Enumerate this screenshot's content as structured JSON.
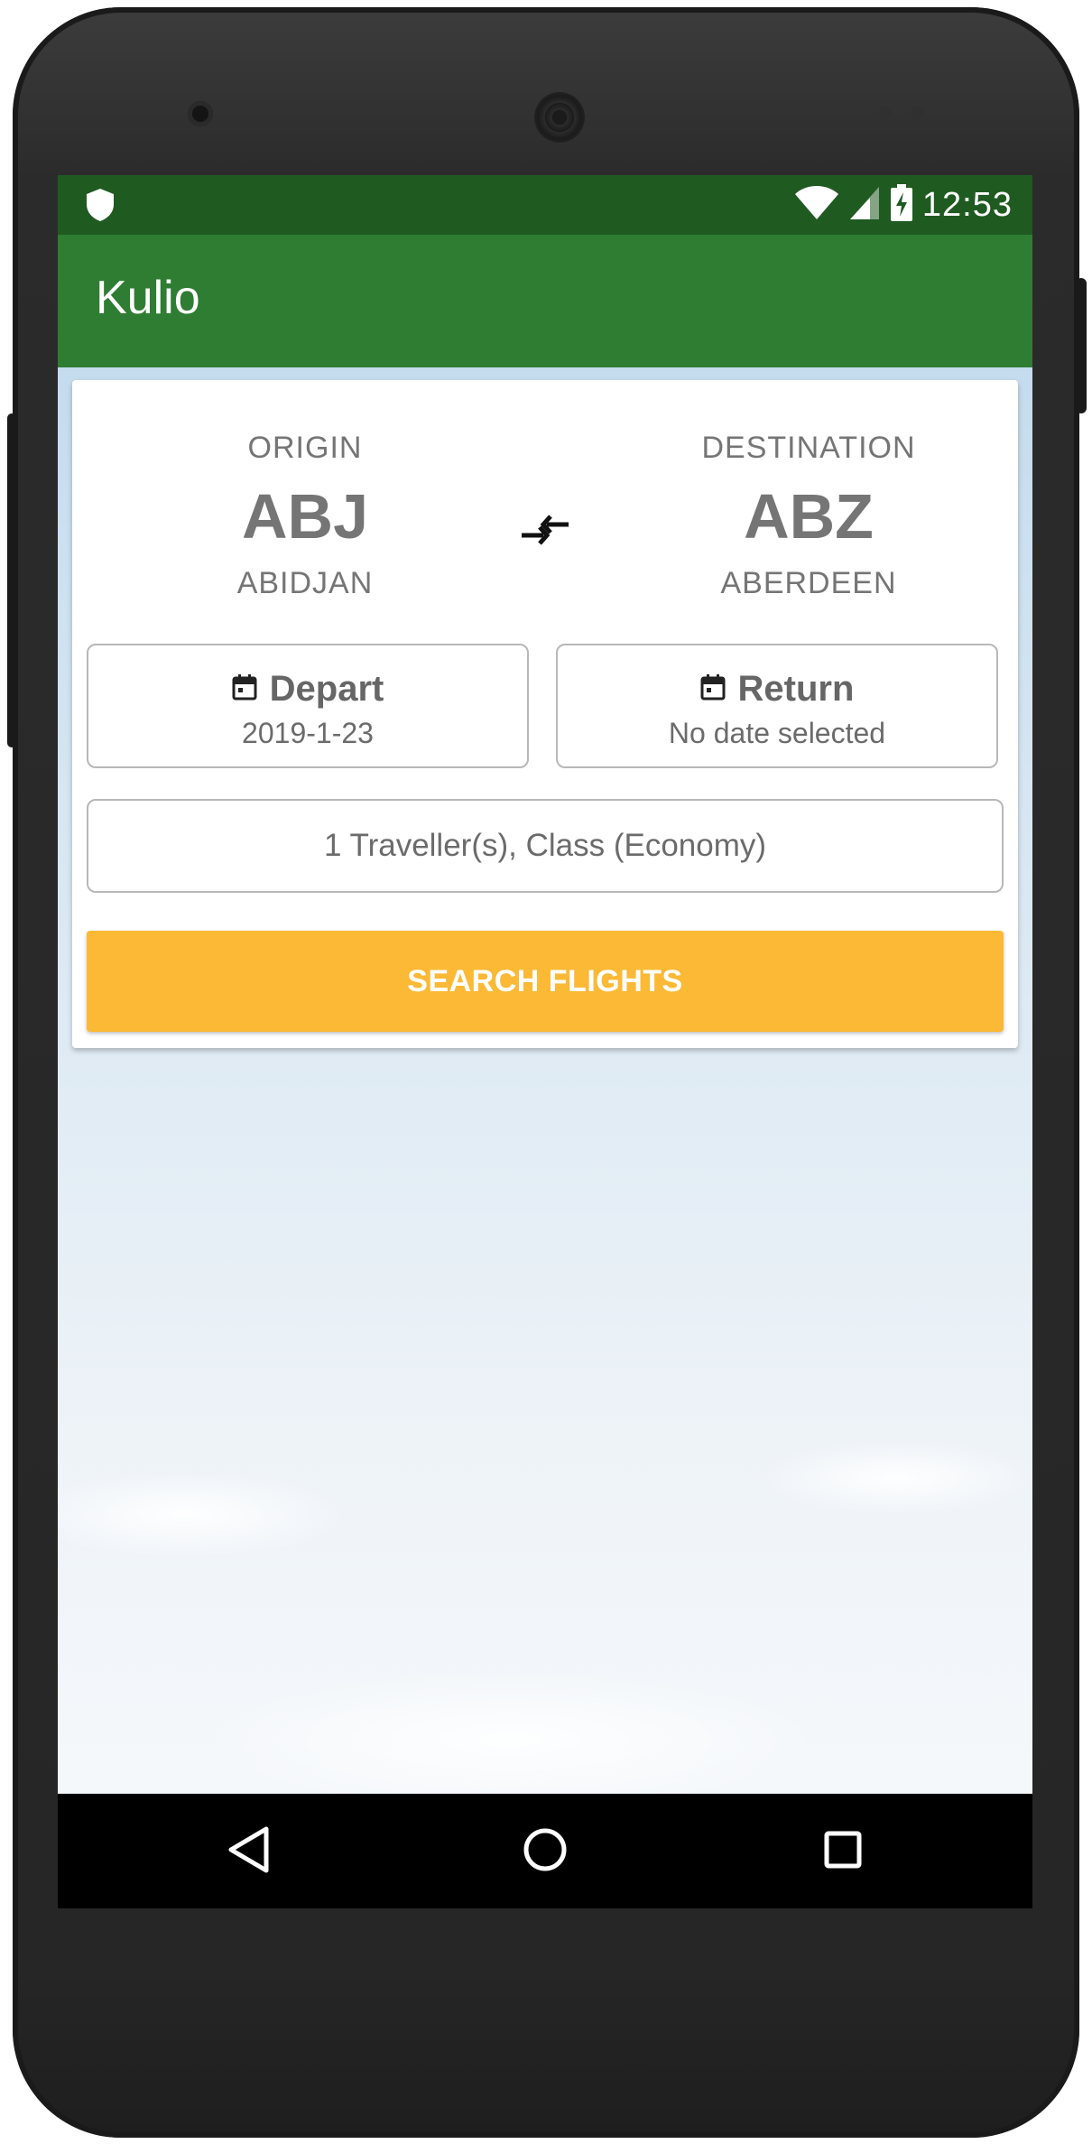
{
  "status_bar": {
    "time": "12:53",
    "icons": [
      "shield-icon",
      "wifi-icon",
      "cell-signal-icon",
      "battery-charging-icon"
    ]
  },
  "app_bar": {
    "title": "Kulio"
  },
  "search_form": {
    "origin": {
      "label": "ORIGIN",
      "code": "ABJ",
      "city": "ABIDJAN"
    },
    "destination": {
      "label": "DESTINATION",
      "code": "ABZ",
      "city": "ABERDEEN"
    },
    "swap_icon": "swap-horizontal-icon",
    "depart": {
      "label": "Depart",
      "value": "2019-1-23",
      "icon": "calendar-icon"
    },
    "return": {
      "label": "Return",
      "value": "No date selected",
      "icon": "calendar-icon"
    },
    "travellers": "1 Traveller(s), Class (Economy)",
    "search_button": "SEARCH FLIGHTS"
  },
  "navigation": {
    "icons": [
      "back-triangle-icon",
      "home-circle-icon",
      "recent-apps-square-icon"
    ]
  },
  "colors": {
    "status_bar": "#1f5a21",
    "app_bar": "#2e7d32",
    "accent_button": "#fbb935",
    "text_muted": "#757575"
  }
}
